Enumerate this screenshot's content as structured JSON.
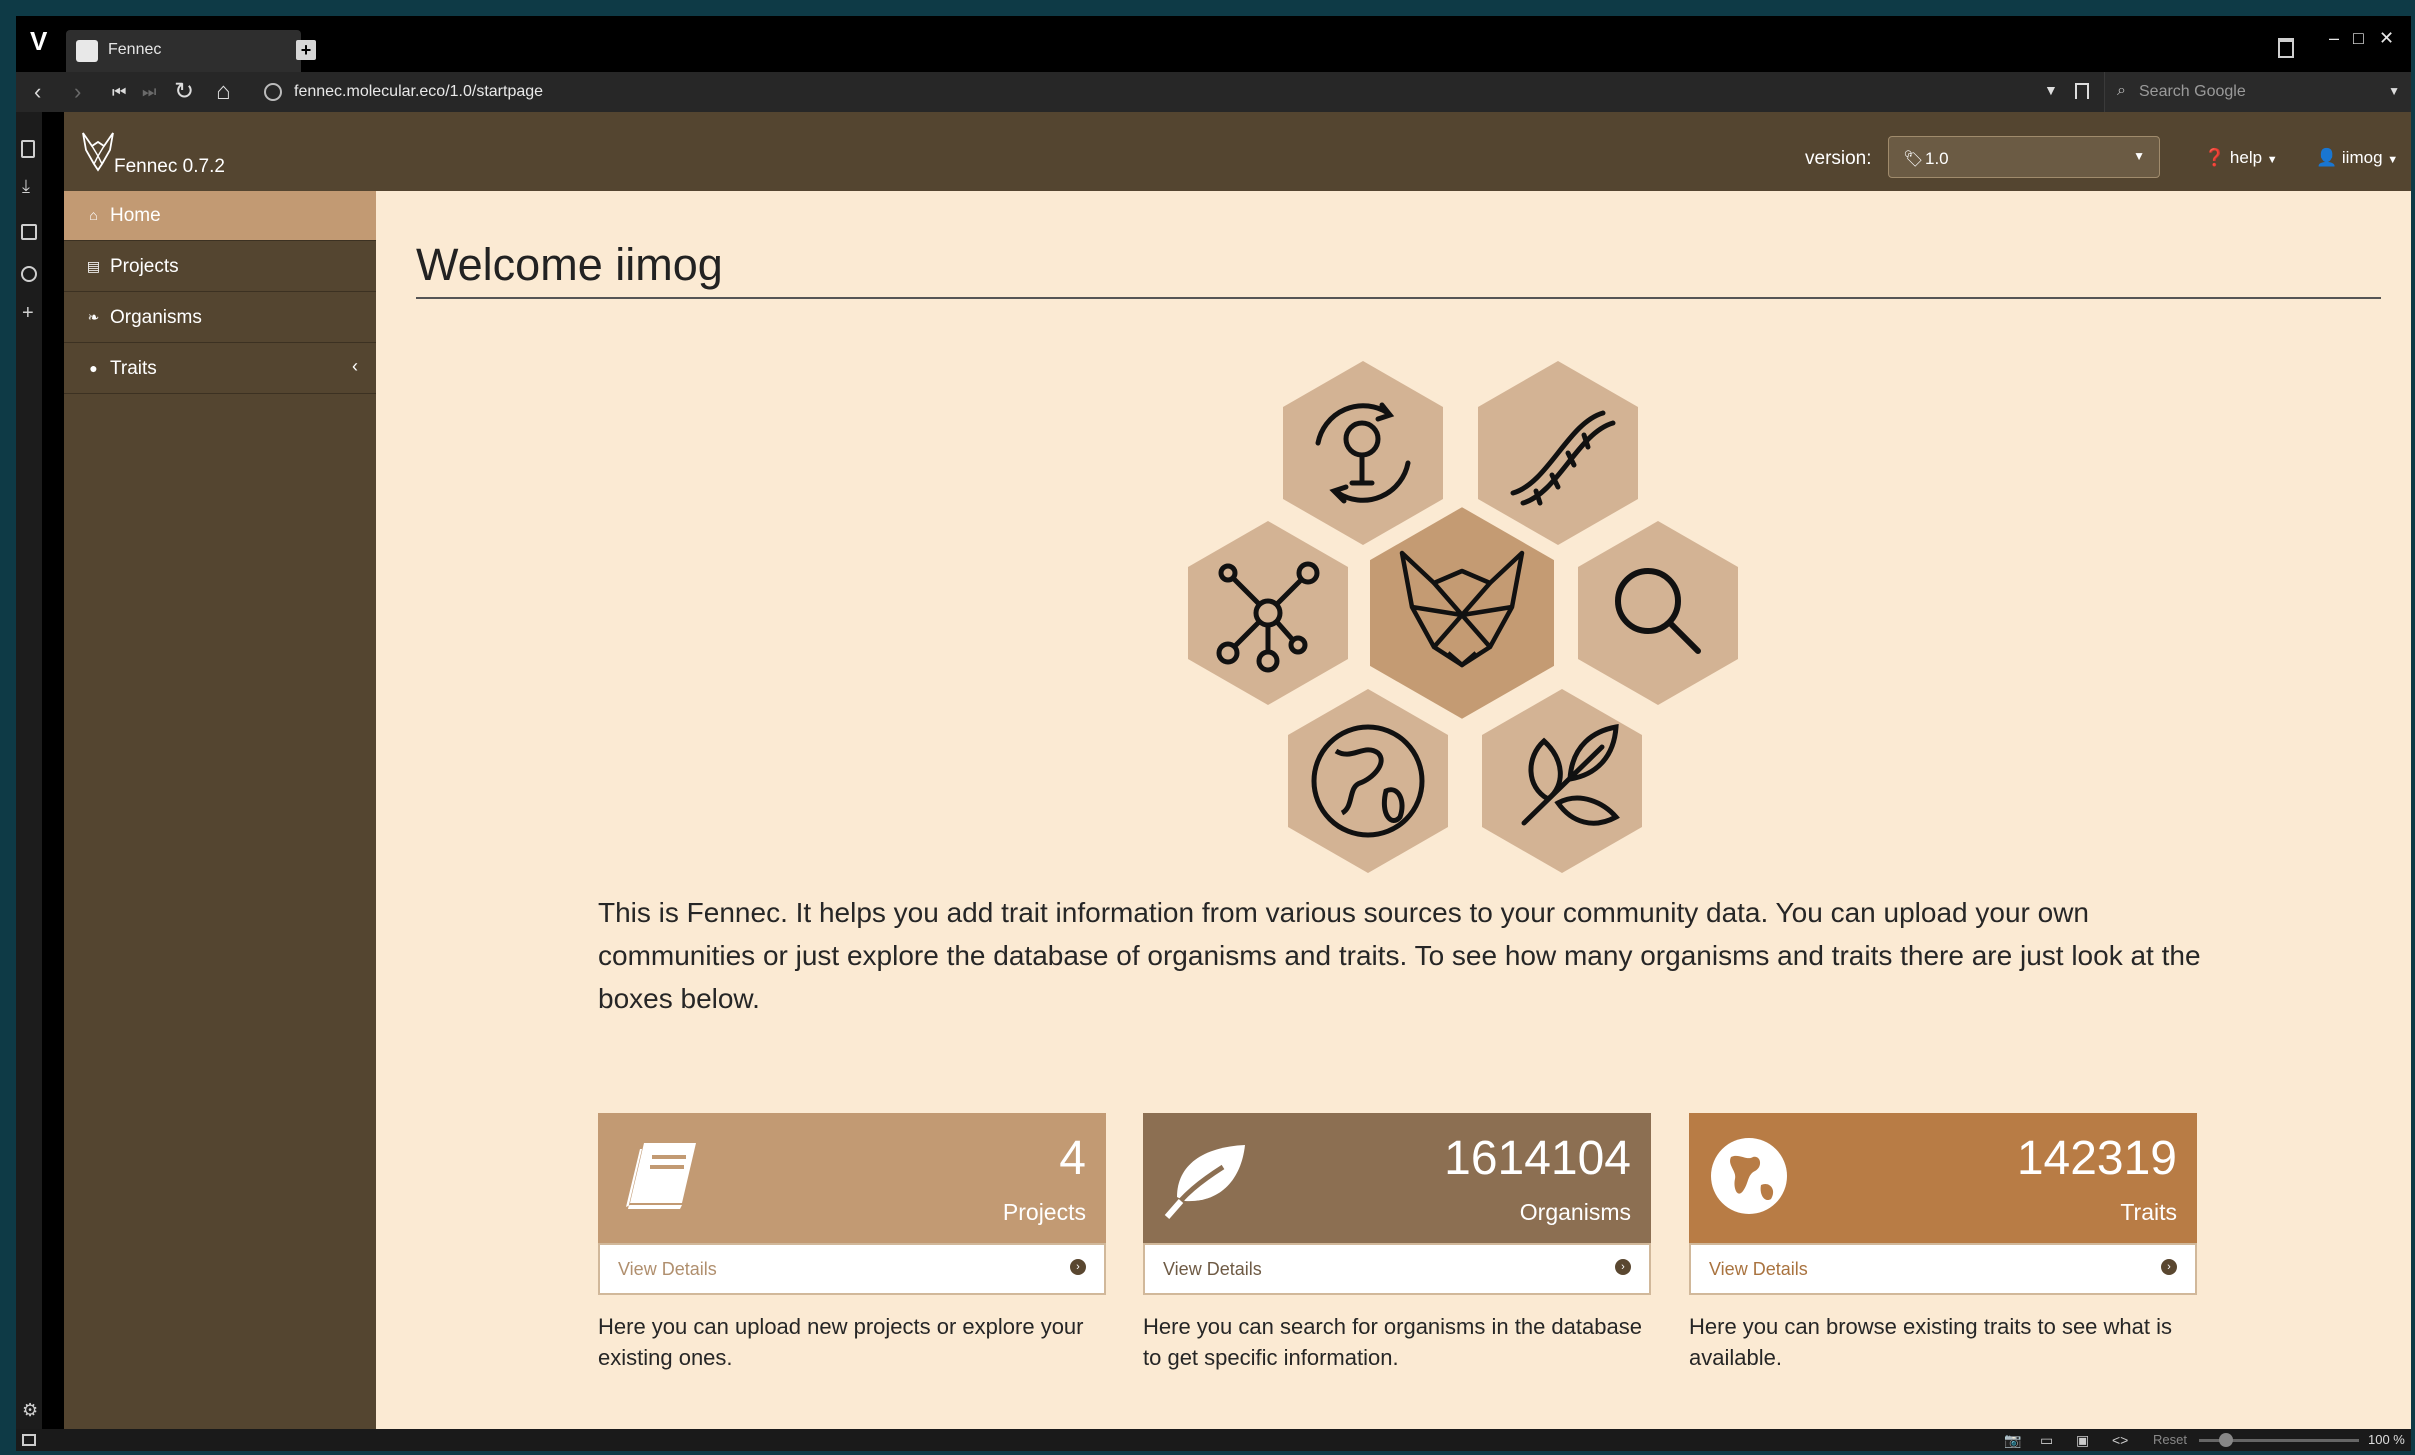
{
  "browser": {
    "tab_title": "Fennec",
    "url": "fennec.molecular.eco/1.0/startpage",
    "search_placeholder": "Search Google",
    "zoom_reset": "Reset",
    "zoom_level": "100 %"
  },
  "app": {
    "brand": "Fennec 0.7.2",
    "version_label": "version:",
    "version_value": "1.0",
    "help_label": "help",
    "user_label": "iimog"
  },
  "sidebar": {
    "items": [
      {
        "label": "Home",
        "icon": "home-icon",
        "active": true
      },
      {
        "label": "Projects",
        "icon": "book-icon"
      },
      {
        "label": "Organisms",
        "icon": "leaf-icon"
      },
      {
        "label": "Traits",
        "icon": "globe-icon"
      }
    ]
  },
  "main": {
    "title": "Welcome iimog",
    "intro": "This is Fennec. It helps you add trait information from various sources to your community data. You can upload your own communities or just explore the database of organisms and traits. To see how many organisms and traits there are just look at the boxes below.",
    "panels": [
      {
        "count": "4",
        "label": "Projects",
        "details": "View Details",
        "description": "Here you can upload new projects or explore your existing ones.",
        "color": "#c29a73"
      },
      {
        "count": "1614104",
        "label": "Organisms",
        "details": "View Details",
        "description": "Here you can search for organisms in the database to get specific information.",
        "color": "#8c6f52"
      },
      {
        "count": "142319",
        "label": "Traits",
        "details": "View Details",
        "description": "Here you can browse existing traits to see what is available.",
        "color": "#b87c45"
      }
    ]
  },
  "colors": {
    "nav_bg": "#544530",
    "page_bg": "#fbead3",
    "hex_fill": "#d3b394",
    "hex_center_fill": "#c49b73"
  }
}
